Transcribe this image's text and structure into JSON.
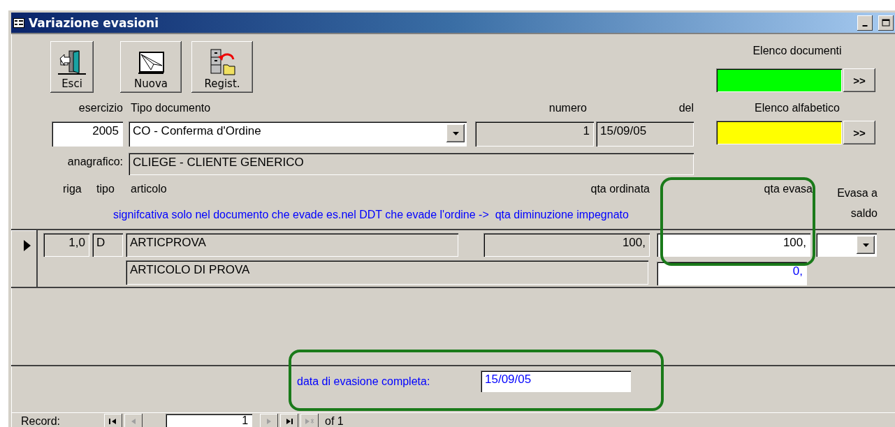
{
  "window": {
    "title": "Variazione evasioni"
  },
  "toolbar_buttons": [
    {
      "kind": "exit",
      "label": "Esci"
    },
    {
      "kind": "new",
      "label": "Nuova"
    },
    {
      "kind": "save",
      "label": "Regist."
    }
  ],
  "lookups": [
    {
      "label": "Elenco documenti",
      "color": "#00ff00",
      "button": ">>"
    },
    {
      "label": "Elenco alfabetico",
      "color": "#ffff00",
      "button": ">>"
    }
  ],
  "header": {
    "esercizio_label": "esercizio",
    "esercizio": "2005",
    "tipo_label": "Tipo documento",
    "tipo": "CO - Conferma d'Ordine",
    "numero_label": "numero",
    "numero": "1",
    "del_label": "del",
    "del": "15/09/05",
    "anagrafico_label": "anagrafico:",
    "anagrafico": "CLIEGE - CLIENTE GENERICO"
  },
  "columns": [
    "riga",
    "tipo",
    "articolo",
    "qta ordinata",
    "qta evasa",
    "Evasa a saldo"
  ],
  "note": "signifcativa solo nel documento che evade es.nel DDT che evade l'ordine ->  qta diminuzione impegnato",
  "rows": [
    {
      "current": true,
      "riga": "1,0",
      "tipo": "D",
      "articolo": "ARTICPROVA",
      "descrizione": "ARTICOLO DI PROVA",
      "qta_ordinata": "100,",
      "qta_evasa": "100,",
      "qta_diminuzione": "0,"
    }
  ],
  "footer": {
    "label": "data di evasione completa:",
    "value": "15/09/05"
  },
  "navigation": {
    "label": "Record:",
    "current": "1",
    "of_label": "of",
    "total": "1",
    "buttons_before": [
      {
        "kind": "first",
        "disabled": false
      },
      {
        "kind": "prev",
        "disabled": true
      }
    ],
    "buttons_after": [
      {
        "kind": "next",
        "disabled": true
      },
      {
        "kind": "last",
        "disabled": false
      },
      {
        "kind": "new",
        "disabled": true
      }
    ]
  }
}
